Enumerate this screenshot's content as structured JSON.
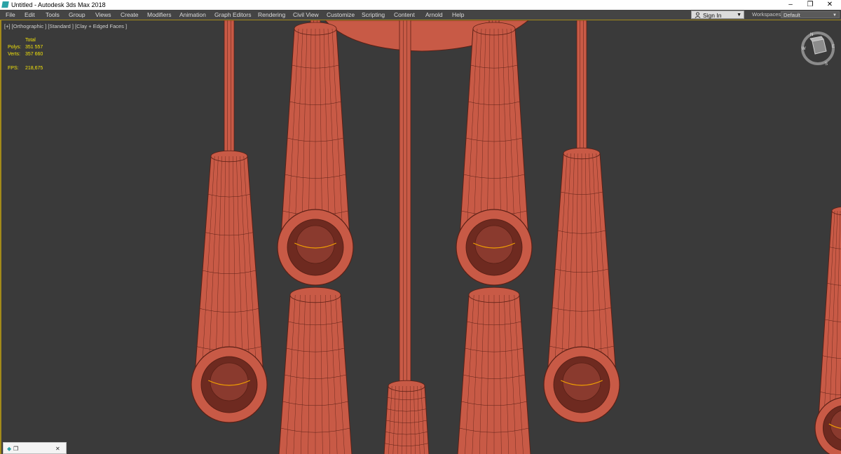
{
  "window": {
    "title": "Untitled - Autodesk 3ds Max 2018",
    "controls": {
      "minimize": "–",
      "restore": "❐",
      "close": "✕"
    }
  },
  "menubar": {
    "items": [
      "File",
      "Edit",
      "Tools",
      "Group",
      "Views",
      "Create",
      "Modifiers",
      "Animation",
      "Graph Editors",
      "Rendering",
      "Civil View",
      "Customize",
      "Scripting",
      "Content",
      "Arnold",
      "Help"
    ],
    "sign_in": "Sign In",
    "workspaces_label": "Workspaces:",
    "workspaces_value": "Default"
  },
  "viewport": {
    "label": "[+] [Orthographic ] [Standard ] [Clay + Edged Faces ]",
    "stats": {
      "header": "Total",
      "polys_label": "Polys:",
      "polys_value": "351 557",
      "verts_label": "Verts:",
      "verts_value": "357 660",
      "fps_label": "FPS:",
      "fps_value": "218,675"
    },
    "viewcube_icon": "viewcube-icon"
  },
  "colors": {
    "clay": "#c85a46",
    "clay_dark": "#6e2a20",
    "edge": "#5a2016",
    "viewport_bg": "#3a3a3a",
    "stats": "#f2e20a",
    "selection_ring": "#f2a100"
  },
  "taskbar": {
    "icons": [
      "max-app-icon",
      "window-icon",
      "close-icon"
    ],
    "close_glyph": "✕"
  }
}
